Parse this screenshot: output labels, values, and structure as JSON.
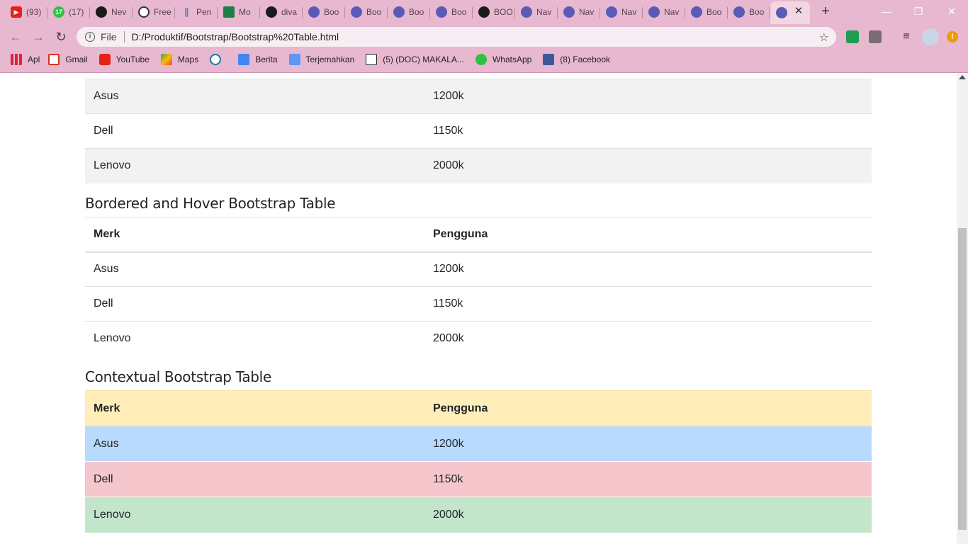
{
  "browser": {
    "tabs": [
      {
        "label": "(93)",
        "icon": "youtube-icon"
      },
      {
        "label": "(17)",
        "icon": "whatsapp-icon"
      },
      {
        "label": "Nev",
        "icon": "github-icon"
      },
      {
        "label": "Free",
        "icon": "figma-icon"
      },
      {
        "label": "Pen",
        "icon": "pen-icon"
      },
      {
        "label": "Mo",
        "icon": "classroom-icon"
      },
      {
        "label": "diva",
        "icon": "github-icon"
      },
      {
        "label": "Boo",
        "icon": "globe-icon"
      },
      {
        "label": "Boo",
        "icon": "globe-icon"
      },
      {
        "label": "Boo",
        "icon": "globe-icon"
      },
      {
        "label": "Boo",
        "icon": "globe-icon"
      },
      {
        "label": "BOO",
        "icon": "github-icon"
      },
      {
        "label": "Nav",
        "icon": "globe-icon"
      },
      {
        "label": "Nav",
        "icon": "globe-icon"
      },
      {
        "label": "Nav",
        "icon": "globe-icon"
      },
      {
        "label": "Nav",
        "icon": "globe-icon"
      },
      {
        "label": "Boo",
        "icon": "globe-icon"
      },
      {
        "label": "Boo",
        "icon": "globe-icon"
      },
      {
        "label": "",
        "icon": "globe-icon"
      }
    ],
    "address": {
      "scheme": "File",
      "url": "D:/Produktif/Bootstrap/Bootstrap%20Table.html"
    },
    "bookmarks": [
      {
        "label": "Apl",
        "icon": "apps-icon"
      },
      {
        "label": "Gmail",
        "icon": "gmail-icon"
      },
      {
        "label": "YouTube",
        "icon": "youtube-icon"
      },
      {
        "label": "Maps",
        "icon": "maps-icon"
      },
      {
        "label": "",
        "icon": "wordpress-icon"
      },
      {
        "label": "Berita",
        "icon": "news-icon"
      },
      {
        "label": "Terjemahkan",
        "icon": "translate-icon"
      },
      {
        "label": "(5) (DOC) MAKALA...",
        "icon": "academia-icon"
      },
      {
        "label": "WhatsApp",
        "icon": "whatsapp-icon"
      },
      {
        "label": "(8) Facebook",
        "icon": "facebook-icon"
      }
    ],
    "warn_badge": "!",
    "colors": {
      "chrome": "#e7b8cf",
      "active_tab": "#f3d6e4"
    }
  },
  "striped_table": {
    "rows": [
      {
        "merk": "Asus",
        "pengguna": "1200k"
      },
      {
        "merk": "Dell",
        "pengguna": "1150k"
      },
      {
        "merk": "Lenovo",
        "pengguna": "2000k"
      }
    ]
  },
  "bordered_table": {
    "heading": "Bordered and Hover Bootstrap Table",
    "headers": [
      "Merk",
      "Pengguna"
    ],
    "rows": [
      {
        "merk": "Asus",
        "pengguna": "1200k"
      },
      {
        "merk": "Dell",
        "pengguna": "1150k"
      },
      {
        "merk": "Lenovo",
        "pengguna": "2000k"
      }
    ]
  },
  "contextual_table": {
    "heading": "Contextual Bootstrap Table",
    "headers": [
      "Merk",
      "Pengguna"
    ],
    "rows": [
      {
        "merk": "Asus",
        "pengguna": "1200k",
        "context": "primary"
      },
      {
        "merk": "Dell",
        "pengguna": "1150k",
        "context": "danger"
      },
      {
        "merk": "Lenovo",
        "pengguna": "2000k",
        "context": "success"
      }
    ],
    "colors": {
      "warning": "#ffeeba",
      "primary": "#b8daff",
      "danger": "#f5c6cb",
      "success": "#c3e6cb"
    }
  }
}
